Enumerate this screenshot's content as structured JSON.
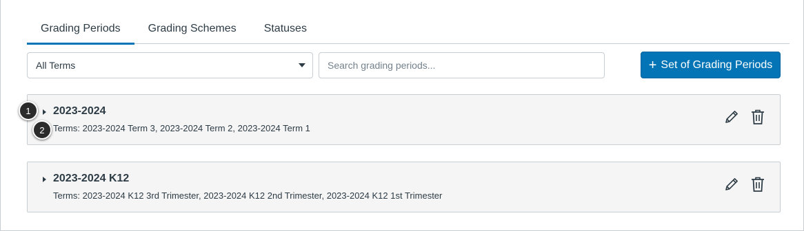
{
  "tabs": [
    {
      "label": "Grading Periods",
      "active": true
    },
    {
      "label": "Grading Schemes",
      "active": false
    },
    {
      "label": "Statuses",
      "active": false
    }
  ],
  "toolbar": {
    "term_filter": "All Terms",
    "search_placeholder": "Search grading periods...",
    "add_button_icon": "+",
    "add_button_label": "Set of Grading Periods"
  },
  "sets": [
    {
      "title": "2023-2024",
      "terms": "Terms: 2023-2024 Term 3, 2023-2024 Term 2, 2023-2024 Term 1"
    },
    {
      "title": "2023-2024 K12",
      "terms": "Terms: 2023-2024 K12 3rd Trimester, 2023-2024 K12 2nd Trimester, 2023-2024 K12 1st Trimester"
    }
  ],
  "callouts": [
    "1",
    "2"
  ],
  "colors": {
    "accent": "#0374b5",
    "card_bg": "#f5f5f5",
    "border": "#c7cdd1",
    "text": "#2d3b45"
  },
  "icons": [
    "chevron-down-icon",
    "plus-icon",
    "triangle-right-icon",
    "pencil-icon",
    "trash-icon"
  ]
}
